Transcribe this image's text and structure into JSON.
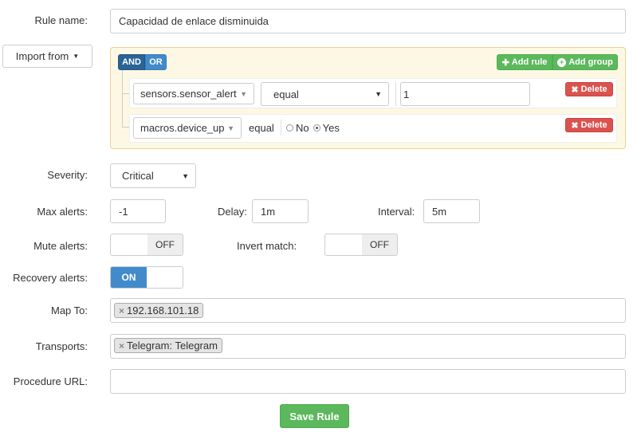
{
  "rule_name": {
    "label": "Rule name:",
    "value": "Capacidad de enlace disminuida"
  },
  "import": {
    "label": "Import from"
  },
  "builder": {
    "and_label": "AND",
    "or_label": "OR",
    "add_rule_label": "Add rule",
    "add_group_label": "Add group",
    "rules": [
      {
        "field": "sensors.sensor_alert",
        "operator": "equal",
        "value": "1",
        "delete_label": "Delete"
      },
      {
        "field": "macros.device_up",
        "operator": "equal",
        "radio_no": "No",
        "radio_yes": "Yes",
        "selected": "Yes",
        "delete_label": "Delete"
      }
    ]
  },
  "severity": {
    "label": "Severity:",
    "value": "Critical"
  },
  "max_alerts": {
    "label": "Max alerts:",
    "value": "-1"
  },
  "delay": {
    "label": "Delay:",
    "value": "1m"
  },
  "interval": {
    "label": "Interval:",
    "value": "5m"
  },
  "mute_alerts": {
    "label": "Mute alerts:",
    "state": "OFF"
  },
  "invert_match": {
    "label": "Invert match:",
    "state": "OFF"
  },
  "recovery_alerts": {
    "label": "Recovery alerts:",
    "state": "ON"
  },
  "map_to": {
    "label": "Map To:",
    "tags": [
      "192.168.101.18"
    ]
  },
  "transports": {
    "label": "Transports:",
    "tags": [
      "Telegram: Telegram"
    ]
  },
  "procedure_url": {
    "label": "Procedure URL:",
    "value": ""
  },
  "save_label": "Save Rule",
  "colors": {
    "primary": "#428bca",
    "success": "#5cb85c",
    "danger": "#d9534f",
    "builder_bg": "#fcf8e3",
    "builder_border": "#f0d18e"
  }
}
